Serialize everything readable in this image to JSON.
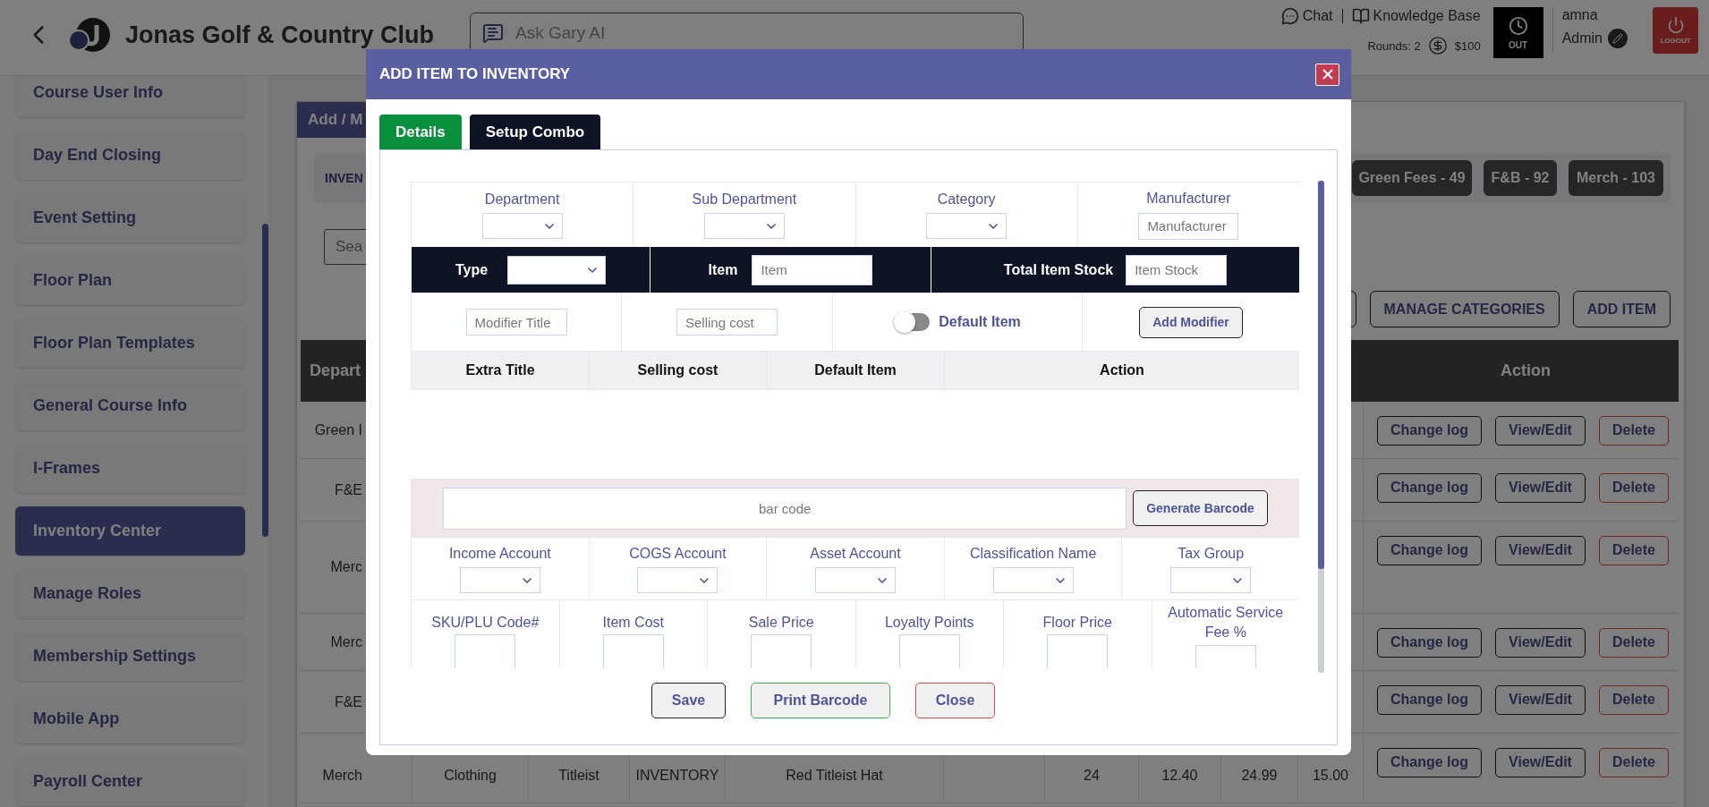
{
  "header": {
    "title": "Jonas Golf & Country Club",
    "ai_search": {
      "placeholder": "Ask Gary AI"
    },
    "links": [
      {
        "label": "Chat",
        "kind": "chat"
      },
      {
        "label": "Knowledge Base",
        "kind": "book"
      }
    ],
    "rounds": "Rounds: 2",
    "balance": "$100",
    "clock_button": "OUT",
    "user": {
      "name": "amna",
      "role": "Admin"
    },
    "logout": "LOGOUT"
  },
  "sidebar": {
    "items": [
      {
        "label": "Course User Info",
        "selected": false
      },
      {
        "label": "Day End Closing",
        "selected": false
      },
      {
        "label": "Event Setting",
        "selected": false
      },
      {
        "label": "Floor Plan",
        "selected": false
      },
      {
        "label": "Floor Plan Templates",
        "selected": false
      },
      {
        "label": "General Course Info",
        "selected": false
      },
      {
        "label": "I-Frames",
        "selected": false
      },
      {
        "label": "Inventory Center",
        "selected": true
      },
      {
        "label": "Manage Roles",
        "selected": false
      },
      {
        "label": "Membership Settings",
        "selected": false
      },
      {
        "label": "Mobile App",
        "selected": false
      },
      {
        "label": "Payroll Center",
        "selected": false
      }
    ]
  },
  "panel": {
    "tab": "Add / M",
    "filter_label": "INVEN",
    "chips": [
      "Green Fees - 49",
      "F&B - 92",
      "Merch - 103"
    ],
    "search": {
      "placeholder": "Sea"
    },
    "buttons": [
      "MANAGE CATEGORIES",
      "ADD ITEM"
    ],
    "table": {
      "columns": [
        "Depart",
        "Action"
      ],
      "rows": [
        {
          "column_1": "Green I",
          "actions": [
            "Change log",
            "View/Edit",
            "Delete"
          ]
        },
        {
          "column_1": "F&E",
          "actions": [
            "Change log",
            "View/Edit",
            "Delete"
          ]
        },
        {
          "column_1": "Merc",
          "actions": [
            "Change log",
            "View/Edit",
            "Delete"
          ]
        },
        {
          "column_1": "Merc",
          "actions": [
            "Change log",
            "View/Edit",
            "Delete"
          ]
        },
        {
          "column_1": "F&E",
          "actions": [
            "Change log",
            "View/Edit",
            "Delete"
          ]
        },
        {
          "column_1": "Merch",
          "column_2": "Clothing",
          "column_3": "Titleist",
          "column_4": "INVENTORY",
          "column_5": "Red Titleist Hat",
          "column_7": "24",
          "column_8": "12.40",
          "column_9": "24.99",
          "column_10": "15.00",
          "actions": [
            "Change log",
            "View/Edit",
            "Delete"
          ]
        }
      ]
    }
  },
  "modal": {
    "title": "ADD ITEM TO INVENTORY",
    "tabs": [
      {
        "label": "Details",
        "selected": true
      },
      {
        "label": "Setup Combo",
        "selected": false
      }
    ],
    "selects": [
      "Department",
      "Sub Department",
      "Category"
    ],
    "manufacturer": {
      "label": "Manufacturer",
      "placeholder": "Manufacturer"
    },
    "type_row": {
      "type_label": "Type",
      "item_label": "Item",
      "item_placeholder": "Item",
      "stock_label": "Total Item Stock",
      "stock_placeholder": "Item Stock"
    },
    "modifier": {
      "title_placeholder": "Modifier Title",
      "cost_placeholder": "Selling cost",
      "default_toggle": {
        "label": "Default Item",
        "on": false
      },
      "add_button": "Add Modifier"
    },
    "modifier_columns": [
      "Extra Title",
      "Selling cost",
      "Default Item",
      "Action"
    ],
    "barcode": {
      "placeholder": "bar code",
      "button": "Generate Barcode"
    },
    "accounts": [
      "Income Account",
      "COGS Account",
      "Asset Account",
      "Classification Name",
      "Tax Group"
    ],
    "prices": [
      "SKU/PLU Code#",
      "Item Cost",
      "Sale Price",
      "Loyalty Points",
      "Floor Price",
      "Automatic Service Fee %"
    ],
    "footer_buttons": [
      {
        "label": "Save",
        "kind": "save"
      },
      {
        "label": "Print Barcode",
        "kind": "print"
      },
      {
        "label": "Close",
        "kind": "close"
      }
    ]
  }
}
